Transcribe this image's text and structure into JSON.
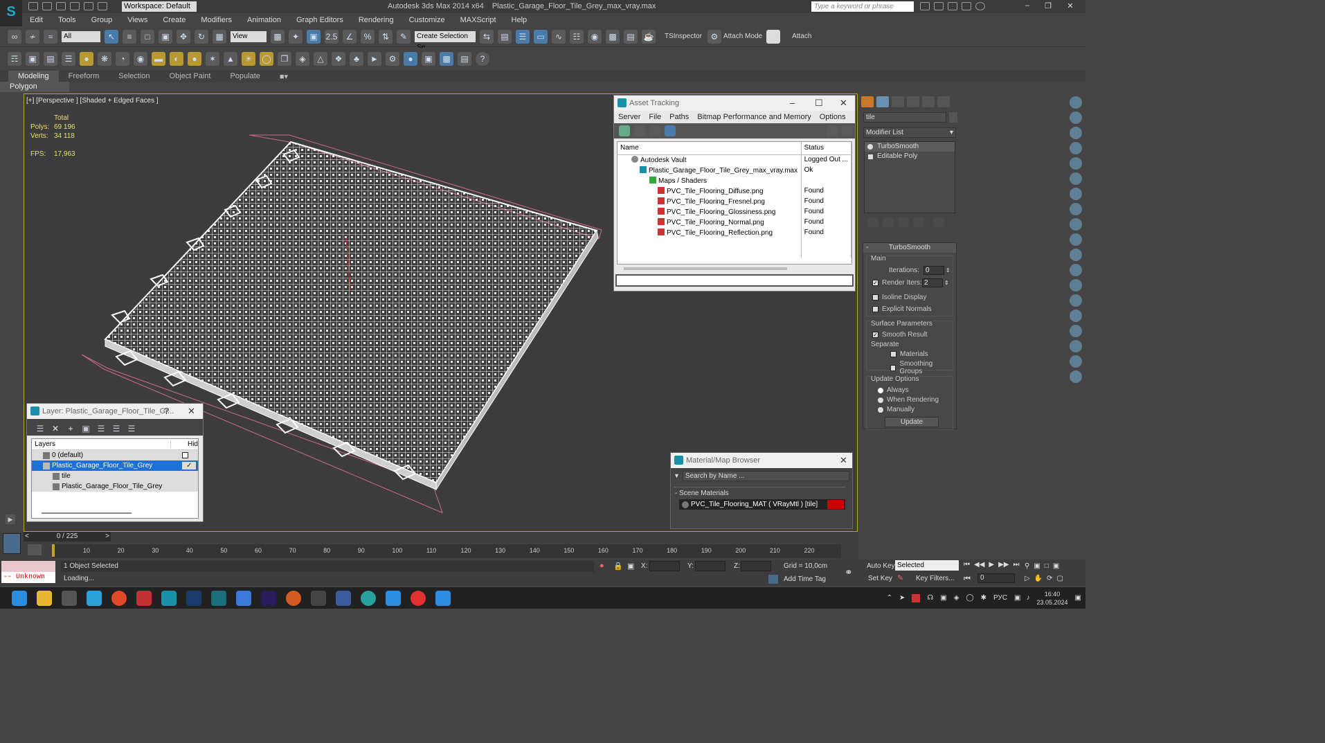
{
  "titlebar": {
    "workspace": "Workspace: Default",
    "app_title": "Autodesk 3ds Max  2014 x64",
    "file_name": "Plastic_Garage_Floor_Tile_Grey_max_vray.max",
    "search_placeholder": "Type a keyword or phrase"
  },
  "menu": [
    "Edit",
    "Tools",
    "Group",
    "Views",
    "Create",
    "Modifiers",
    "Animation",
    "Graph Editors",
    "Rendering",
    "Customize",
    "MAXScript",
    "Help"
  ],
  "toolbar": {
    "selection_filter": "All",
    "ref_coord": "View",
    "snap_value": "2.5",
    "create_selection_set": "Create Selection Se",
    "tsinspector": "TSInspector",
    "attach_mode": "Attach Mode",
    "attach": "Attach"
  },
  "ribbon": {
    "tabs": [
      "Modeling",
      "Freeform",
      "Selection",
      "Object Paint",
      "Populate"
    ],
    "active_panel": "Polygon Modeling"
  },
  "viewport": {
    "label": "[+] [Perspective ] [Shaded + Edged Faces ]",
    "stats_header": "Total",
    "polys_label": "Polys:",
    "polys_value": "69 196",
    "verts_label": "Verts:",
    "verts_value": "34 118",
    "fps_label": "FPS:",
    "fps_value": "17,963"
  },
  "asset_tracking": {
    "title": "Asset Tracking",
    "menu": [
      "Server",
      "File",
      "Paths",
      "Bitmap Performance and Memory",
      "Options"
    ],
    "col_name": "Name",
    "col_status": "Status",
    "rows": [
      {
        "name": "Autodesk Vault",
        "status": "Logged Out ..."
      },
      {
        "name": "Plastic_Garage_Floor_Tile_Grey_max_vray.max",
        "status": "Ok"
      },
      {
        "name": "Maps / Shaders",
        "status": ""
      },
      {
        "name": "PVC_Tile_Flooring_Diffuse.png",
        "status": "Found"
      },
      {
        "name": "PVC_Tile_Flooring_Fresnel.png",
        "status": "Found"
      },
      {
        "name": "PVC_Tile_Flooring_Glossiness.png",
        "status": "Found"
      },
      {
        "name": "PVC_Tile_Flooring_Normal.png",
        "status": "Found"
      },
      {
        "name": "PVC_Tile_Flooring_Reflection.png",
        "status": "Found"
      }
    ]
  },
  "command_panel": {
    "object_name": "tile",
    "modifier_list": "Modifier List",
    "stack": [
      "TurboSmooth",
      "Editable Poly"
    ],
    "rollout_title": "TurboSmooth",
    "main_label": "Main",
    "iterations_label": "Iterations:",
    "iterations_value": "0",
    "render_iters_label": "Render Iters:",
    "render_iters_value": "2",
    "isoline_label": "Isoline Display",
    "explicit_normals_label": "Explicit Normals",
    "surface_params_label": "Surface Parameters",
    "smooth_result_label": "Smooth Result",
    "separate_label": "Separate",
    "materials_label": "Materials",
    "smoothing_groups_label": "Smoothing Groups",
    "update_options_label": "Update Options",
    "always_label": "Always",
    "when_rendering_label": "When Rendering",
    "manually_label": "Manually",
    "update_button": "Update"
  },
  "layer_window": {
    "title": "Layer: Plastic_Garage_Floor_Tile_Gr...",
    "col_layers": "Layers",
    "col_hide": "Hid",
    "rows": [
      "0 (default)",
      "Plastic_Garage_Floor_Tile_Grey",
      "tile",
      "Plastic_Garage_Floor_Tile_Grey"
    ]
  },
  "material_browser": {
    "title": "Material/Map Browser",
    "search_placeholder": "Search by Name ...",
    "section": "- Scene Materials",
    "material": "PVC_Tile_Flooring_MAT  ( VRayMtl ) [tile]"
  },
  "timeline": {
    "frame_counter": "0 / 225",
    "ticks": [
      "10",
      "20",
      "30",
      "40",
      "50",
      "60",
      "70",
      "80",
      "90",
      "100",
      "110",
      "120",
      "130",
      "140",
      "150",
      "160",
      "170",
      "180",
      "190",
      "200",
      "210",
      "220"
    ]
  },
  "status": {
    "maxscript": "-- Unknown p:",
    "selection": "1 Object Selected",
    "loading": "Loading...",
    "x_label": "X:",
    "y_label": "Y:",
    "z_label": "Z:",
    "grid": "Grid = 10,0cm",
    "add_time_tag": "Add Time Tag",
    "auto_key": "Auto Key",
    "selected": "Selected",
    "set_key": "Set Key",
    "key_filters": "Key Filters...",
    "frame_value": "0"
  },
  "taskbar": {
    "language": "РУС",
    "time": "16:40",
    "date": "23.05.2024"
  },
  "colors": {
    "accent": "#c8a12a",
    "selection_blue": "#1e6fd6",
    "wire": "#ffffff"
  }
}
